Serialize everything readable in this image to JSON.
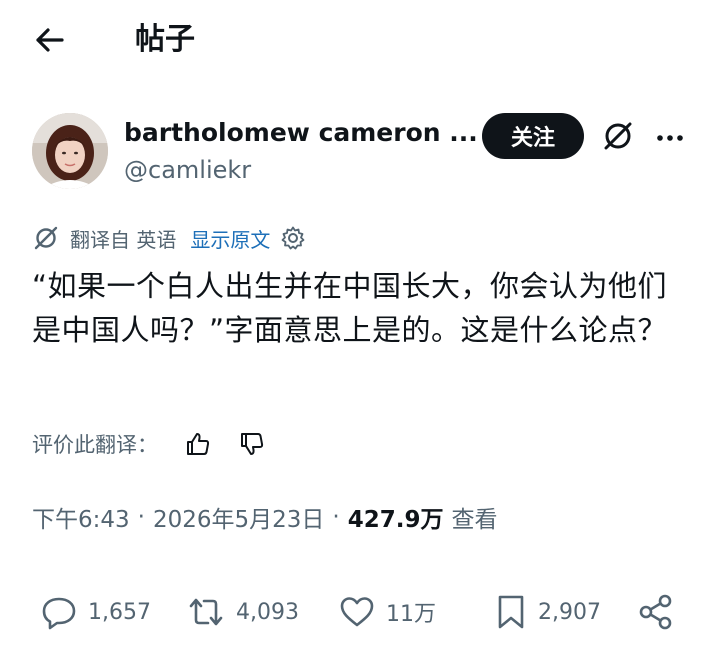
{
  "header": {
    "title": "帖子",
    "back_icon": "arrow-left-icon"
  },
  "author": {
    "name": "bartholomew cameron ...",
    "handle": "@camliekr",
    "follow_label": "关注"
  },
  "translation": {
    "label": "翻译自 英语",
    "show_original": "显示原文"
  },
  "post": {
    "text": "“如果一个白人出生并在中国长大，你会认为他们是中国人吗？”字面意思上是的。这是什么论点？"
  },
  "rating": {
    "label": "评价此翻译："
  },
  "meta": {
    "time": "下午6:43",
    "separator": "·",
    "date": "2026年5月23日",
    "views_count": "427.9万",
    "views_label": "查看"
  },
  "actions": {
    "reply_count": "1,657",
    "repost_count": "4,093",
    "like_count": "11万",
    "bookmark_count": "2,907"
  },
  "colors": {
    "text": "#0f1419",
    "secondary": "#536471",
    "link": "#1d6fb8",
    "follow_bg": "#0f1419"
  }
}
